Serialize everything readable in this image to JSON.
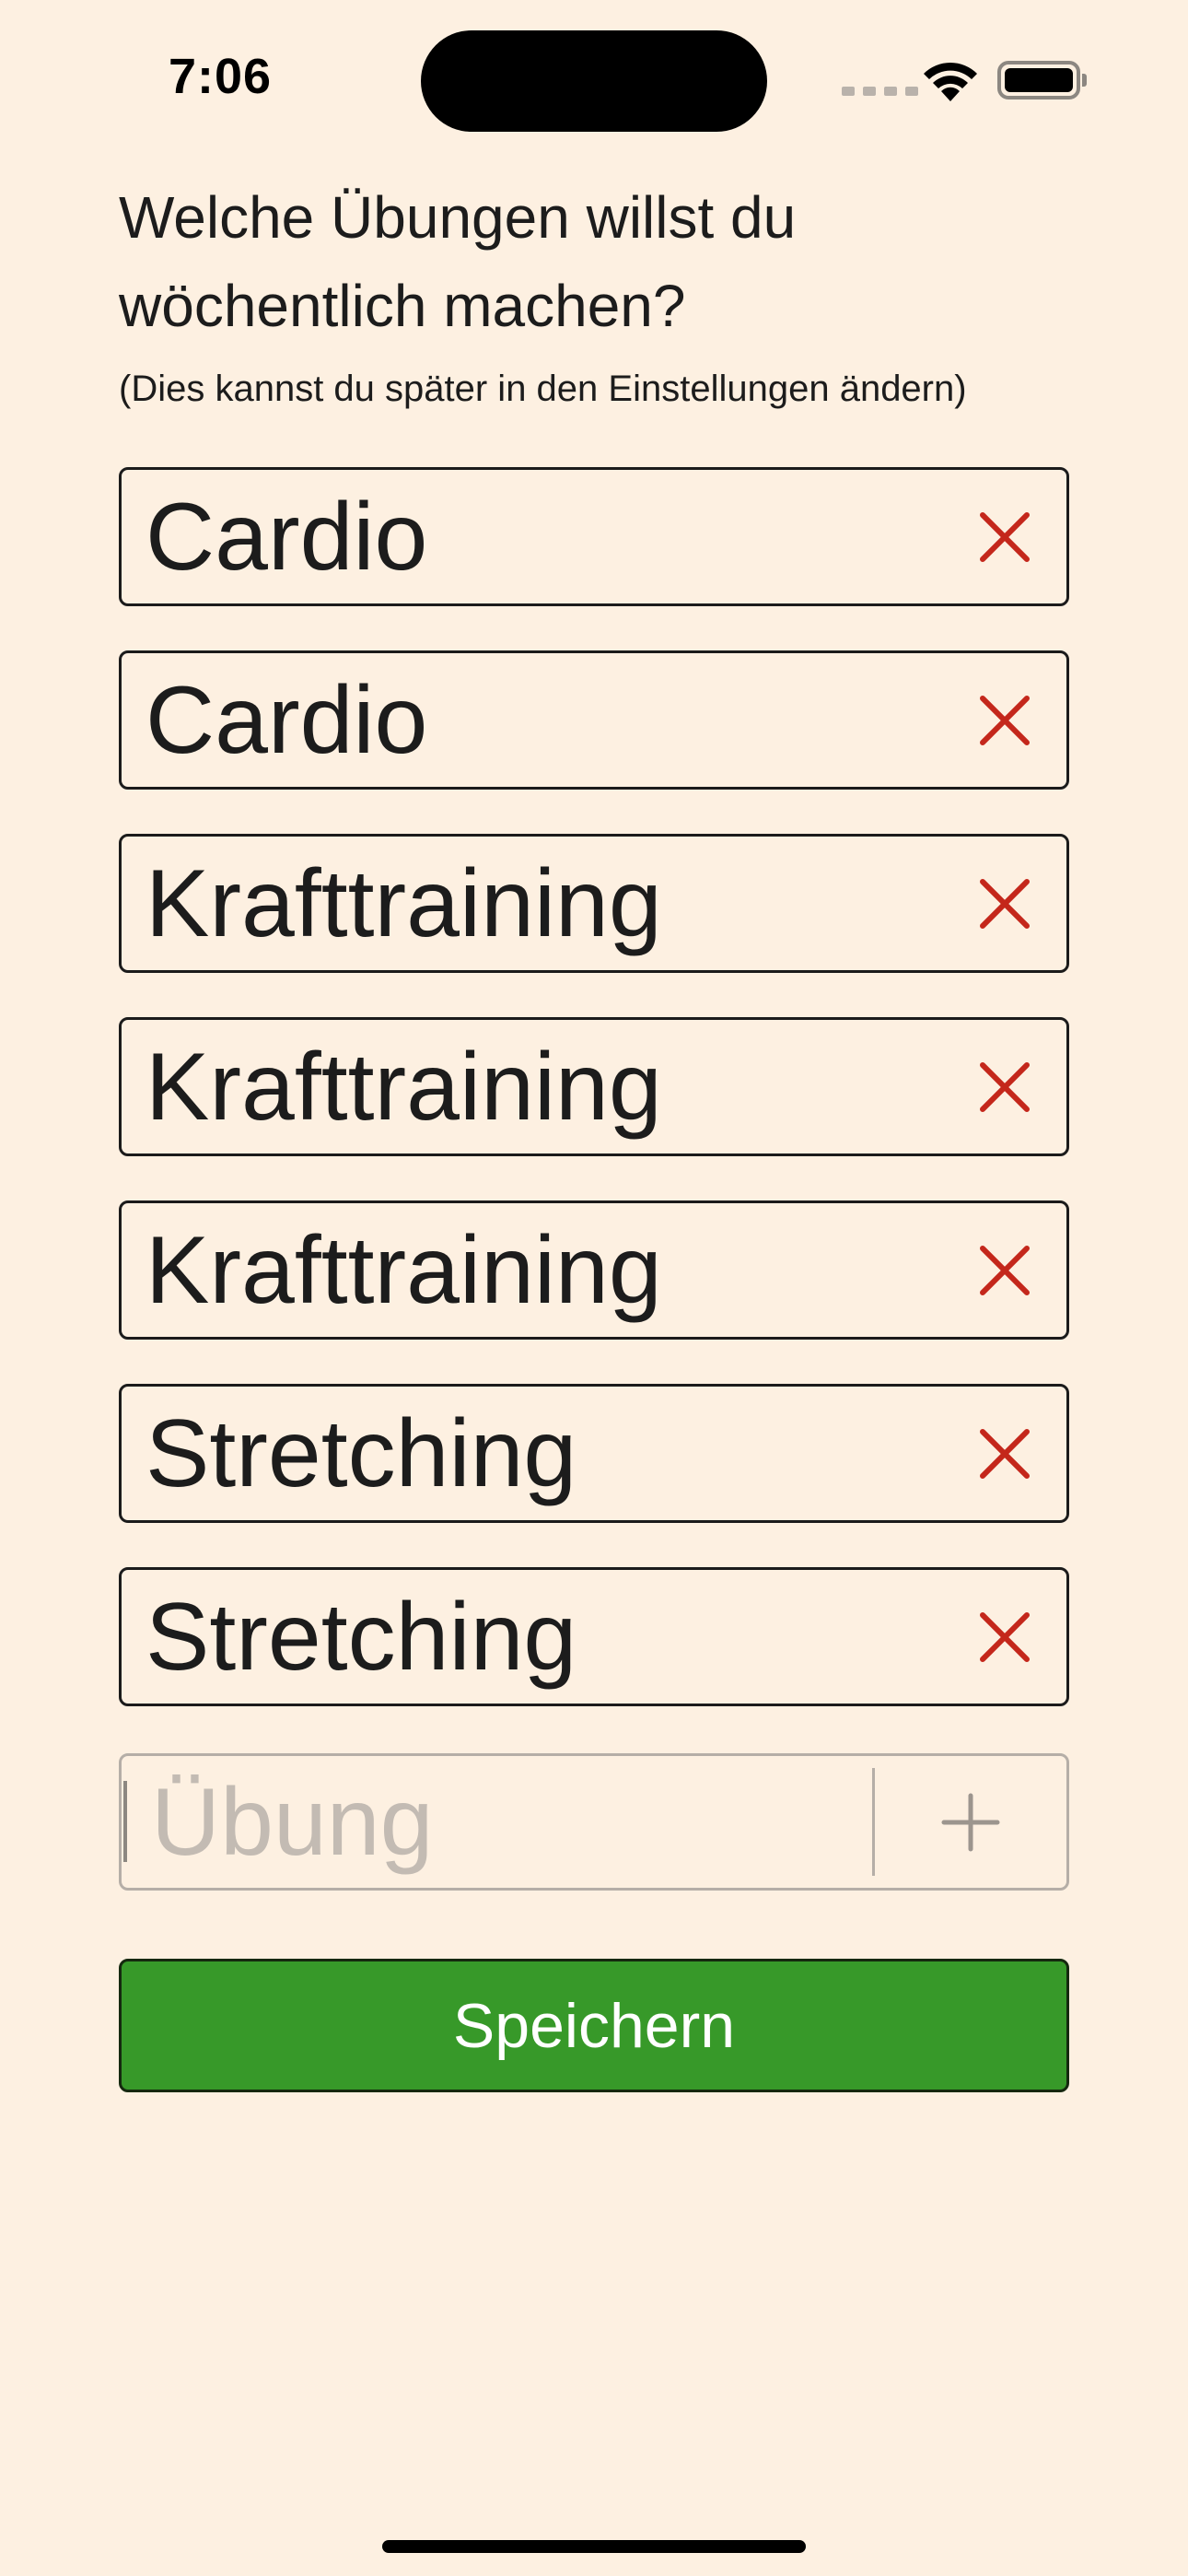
{
  "status_bar": {
    "time": "7:06",
    "wifi_icon": "wifi-icon",
    "battery_icon": "battery-full-icon"
  },
  "heading": "Welche Übungen willst du wöchentlich machen?",
  "subheading": "(Dies kannst du später in den Einstellungen ändern)",
  "exercises": [
    {
      "label": "Cardio"
    },
    {
      "label": "Cardio"
    },
    {
      "label": "Krafttraining"
    },
    {
      "label": "Krafttraining"
    },
    {
      "label": "Krafttraining"
    },
    {
      "label": "Stretching"
    },
    {
      "label": "Stretching"
    }
  ],
  "new_exercise": {
    "value": "",
    "placeholder": "Übung",
    "add_icon": "plus-icon"
  },
  "save_label": "Speichern",
  "colors": {
    "background": "#FDF0E1",
    "remove": "#C4271B",
    "save": "#379929",
    "border": "#1B1B1B"
  }
}
